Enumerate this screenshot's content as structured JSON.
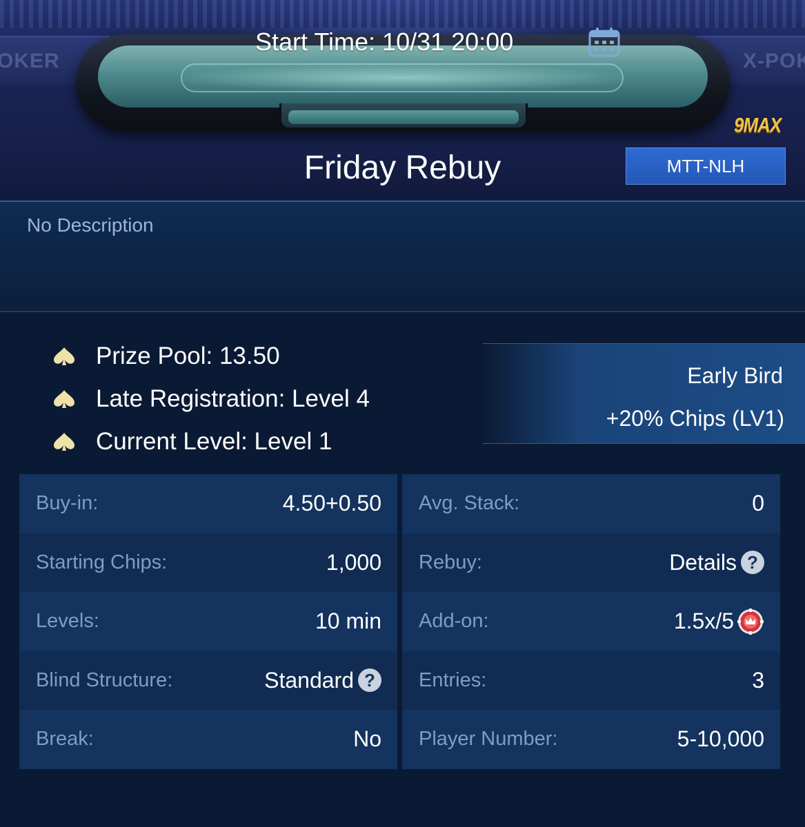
{
  "header": {
    "start_time": "Start Time: 10/31 20:00",
    "max_badge": "9MAX",
    "title": "Friday Rebuy",
    "game_type": "MTT-NLH",
    "wall_text_left": "OKER",
    "wall_text_right": "X-POK"
  },
  "description": "No Description",
  "info": [
    {
      "text": "Prize Pool: 13.50",
      "icon": "spade-icon"
    },
    {
      "text": "Late Registration: Level 4",
      "icon": "spade-icon"
    },
    {
      "text": "Current Level: Level 1",
      "icon": "spade-icon"
    }
  ],
  "early_bird": {
    "title": "Early Bird",
    "detail": "+20% Chips (LV1)"
  },
  "details_left": [
    {
      "label": "Buy-in:",
      "value": "4.50+0.50"
    },
    {
      "label": "Starting Chips:",
      "value": "1,000"
    },
    {
      "label": "Levels:",
      "value": "10 min"
    },
    {
      "label": "Blind Structure:",
      "value": "Standard",
      "icon": "help-icon"
    },
    {
      "label": "Break:",
      "value": "No"
    }
  ],
  "details_right": [
    {
      "label": "Avg. Stack:",
      "value": "0"
    },
    {
      "label": "Rebuy:",
      "value": "Details",
      "icon": "help-icon"
    },
    {
      "label": "Add-on:",
      "value": "1.5x/5",
      "icon": "crown-chip-icon"
    },
    {
      "label": "Entries:",
      "value": "3"
    },
    {
      "label": "Player Number:",
      "value": "5-10,000"
    }
  ],
  "colors": {
    "background": "#0b1a34",
    "badge_blue": "#2e6ad3",
    "label_blue": "#7f9cc7",
    "gold": "#f0c24a",
    "spade": "#efe2a8"
  }
}
